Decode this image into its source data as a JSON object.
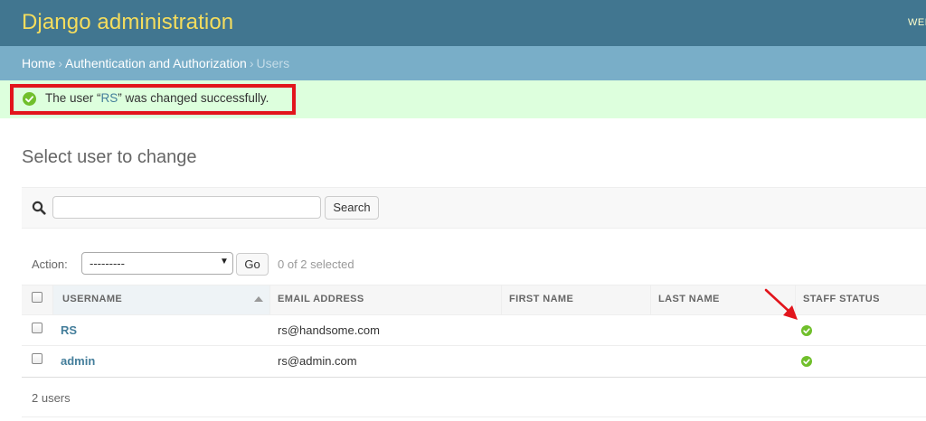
{
  "header": {
    "branding": "Django administration",
    "user_tools": "WELCOME,"
  },
  "breadcrumbs": {
    "home": "Home",
    "app": "Authentication and Authorization",
    "current": "Users",
    "separator": "›"
  },
  "message": {
    "prefix": "The user “",
    "user_link": "RS",
    "suffix": "” was changed successfully.",
    "status_color": "#70bf2b"
  },
  "page": {
    "title": "Select user to change"
  },
  "search": {
    "value": "",
    "placeholder": "",
    "button_label": "Search"
  },
  "actions": {
    "label": "Action:",
    "selected_option": "---------",
    "go_label": "Go",
    "selected_count": "0 of 2 selected"
  },
  "table": {
    "columns": [
      "Username",
      "Email address",
      "First name",
      "Last name",
      "Staff status"
    ],
    "rows": [
      {
        "username": "RS",
        "email": "rs@handsome.com",
        "first_name": "",
        "last_name": "",
        "staff_status": true
      },
      {
        "username": "admin",
        "email": "rs@admin.com",
        "first_name": "",
        "last_name": "",
        "staff_status": true
      }
    ]
  },
  "footer": {
    "count": "2 users"
  },
  "colors": {
    "header_bg": "#417690",
    "branding": "#f5dd5d",
    "breadcrumb_bg": "#79aec8",
    "success_bg": "#ddffdd",
    "link": "#447e9b",
    "highlight": "#e2151c"
  }
}
